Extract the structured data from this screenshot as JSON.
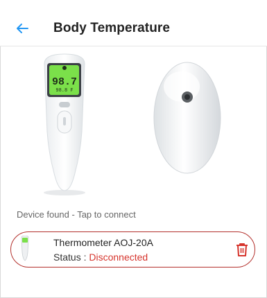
{
  "header": {
    "title": "Body Temperature",
    "back_icon": "arrow-left-icon"
  },
  "device_preview": {
    "display_reading": "98.7",
    "display_sub": "98.8 F",
    "images": [
      "thermometer-front",
      "thermometer-back"
    ]
  },
  "scan": {
    "hint": "Device found - Tap to connect"
  },
  "device": {
    "name": "Thermometer AOJ-20A",
    "status_label": "Status : ",
    "status_value": "Disconnected",
    "delete_icon": "trash-icon"
  },
  "colors": {
    "accent": "#2196f3",
    "danger": "#d6342c",
    "display": "#7be04a"
  }
}
